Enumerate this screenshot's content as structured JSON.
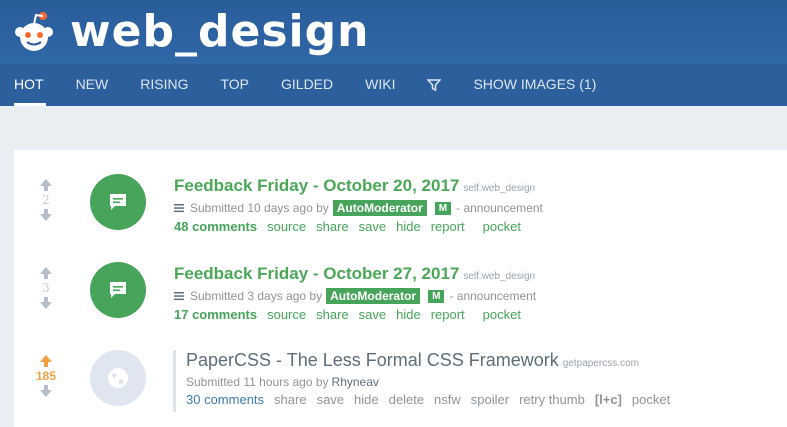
{
  "header": {
    "subreddit": "web_design"
  },
  "nav": {
    "items": [
      {
        "label": "HOT"
      },
      {
        "label": "NEW"
      },
      {
        "label": "RISING"
      },
      {
        "label": "TOP"
      },
      {
        "label": "GILDED"
      },
      {
        "label": "WIKI"
      }
    ],
    "show_images": "SHOW IMAGES (1)"
  },
  "posts": [
    {
      "score": "2",
      "title": "Feedback Friday - October 20, 2017",
      "domain": "self.web_design",
      "submitted": "Submitted 10 days ago by",
      "author": "AutoModerator",
      "mod_badge": "M",
      "flair": "- announcement",
      "buttons": {
        "comments": "48 comments",
        "source": "source",
        "share": "share",
        "save": "save",
        "hide": "hide",
        "report": "report",
        "pocket": "pocket"
      }
    },
    {
      "score": "3",
      "title": "Feedback Friday - October 27, 2017",
      "domain": "self.web_design",
      "submitted": "Submitted 3 days ago by",
      "author": "AutoModerator",
      "mod_badge": "M",
      "flair": "- announcement",
      "buttons": {
        "comments": "17 comments",
        "source": "source",
        "share": "share",
        "save": "save",
        "hide": "hide",
        "report": "report",
        "pocket": "pocket"
      }
    },
    {
      "score": "185",
      "title": "PaperCSS - The Less Formal CSS Framework",
      "domain": "getpapercss.com",
      "submitted": "Submitted 11 hours ago by",
      "author": "Rhyneav",
      "buttons": {
        "comments": "30 comments",
        "share": "share",
        "save": "save",
        "hide": "hide",
        "delete": "delete",
        "nsfw": "nsfw",
        "spoiler": "spoiler",
        "retry_thumb": "retry thumb",
        "lc": "[l+c]",
        "pocket": "pocket"
      }
    }
  ],
  "colors": {
    "header": "#2a5c9a",
    "nav": "#2d5f9d",
    "accent_green": "#46a45b",
    "upvoted": "#f0a040",
    "link_blue": "#3d7bb0"
  },
  "icons": {
    "logo": "reddit-alien-icon",
    "filter": "funnel-icon",
    "self_post": "chat-bubble-icon",
    "link_post": "globe-icon"
  }
}
